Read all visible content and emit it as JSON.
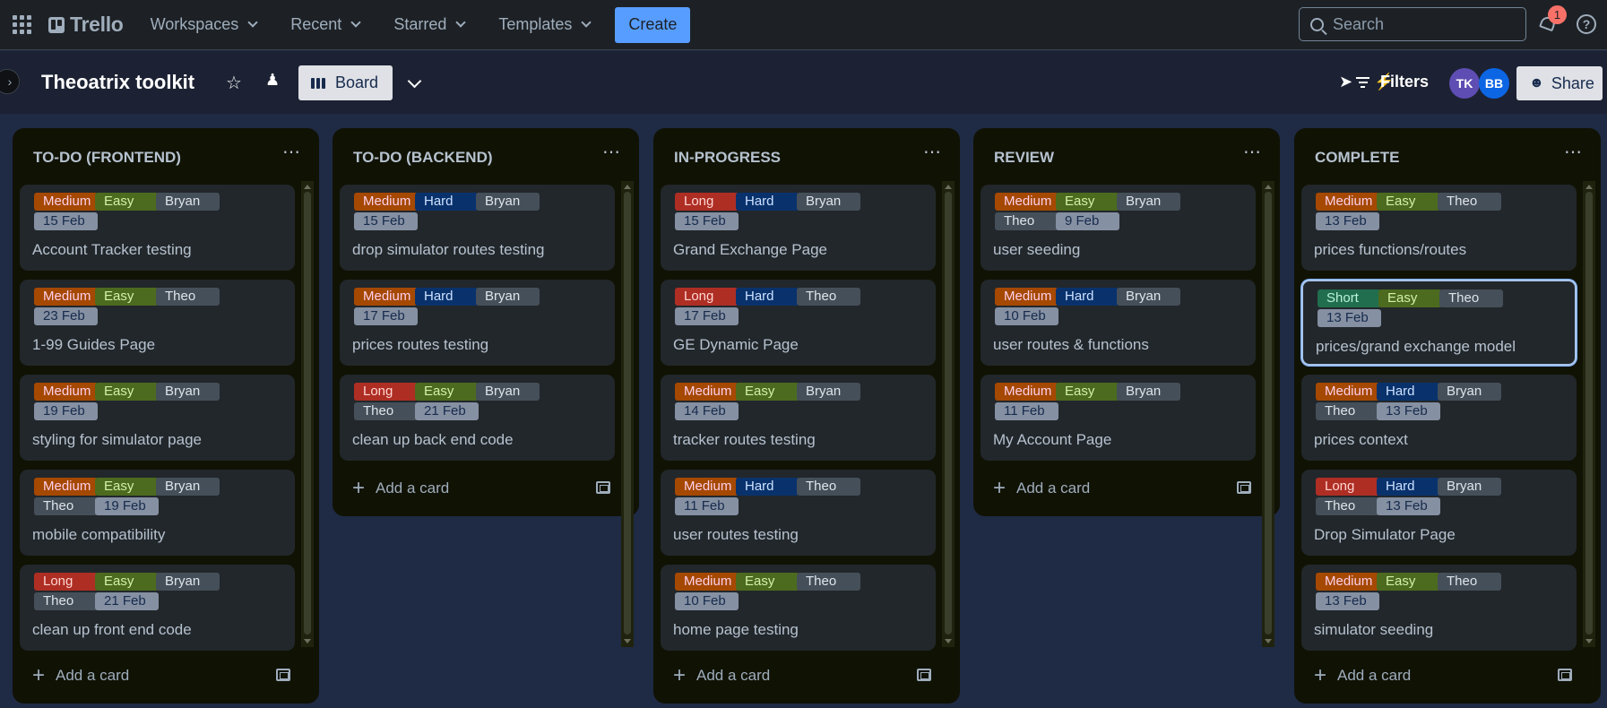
{
  "topnav": {
    "logo": "Trello",
    "menu": [
      "Workspaces",
      "Recent",
      "Starred",
      "Templates"
    ],
    "create_label": "Create",
    "search_placeholder": "Search",
    "notification_count": "1",
    "help_glyph": "?"
  },
  "board": {
    "title": "Theoatrix toolkit",
    "view_label": "Board",
    "filters_label": "Filters",
    "share_label": "Share",
    "members": [
      {
        "initials": "TK",
        "color": "#5e4db2"
      },
      {
        "initials": "BB",
        "color": "#0c66e4"
      }
    ]
  },
  "colors": {
    "Medium": {
      "bg": "#a54800",
      "fg": "#fdd0ec"
    },
    "Long": {
      "bg": "#ae2e24",
      "fg": "#ffd5d2"
    },
    "Short": {
      "bg": "#216e4e",
      "fg": "#baf3db"
    },
    "Easy": {
      "bg": "#4c6b1f",
      "fg": "#d3f1a7"
    },
    "Hard": {
      "bg": "#09326c",
      "fg": "#cce0ff"
    },
    "person": {
      "bg": "#454f59",
      "fg": "#dee4ea"
    },
    "date": {
      "bg": "#8590a2",
      "fg": "#172b4d"
    }
  },
  "add_card_label": "Add a card",
  "lists": [
    {
      "title": "TO-DO (FRONTEND)",
      "cards": [
        {
          "labels": [
            "Medium",
            "Easy",
            "Bryan"
          ],
          "members": [],
          "date": "15 Feb",
          "title": "Account Tracker testing"
        },
        {
          "labels": [
            "Medium",
            "Easy",
            "Theo"
          ],
          "members": [],
          "date": "23 Feb",
          "title": "1-99 Guides Page"
        },
        {
          "labels": [
            "Medium",
            "Easy",
            "Bryan"
          ],
          "members": [],
          "date": "19 Feb",
          "title": "styling for simulator page"
        },
        {
          "labels": [
            "Medium",
            "Easy",
            "Bryan"
          ],
          "members": [
            "Theo"
          ],
          "date": "19 Feb",
          "title": "mobile compatibility"
        },
        {
          "labels": [
            "Long",
            "Easy",
            "Bryan"
          ],
          "members": [
            "Theo"
          ],
          "date": "21 Feb",
          "title": "clean up front end code"
        }
      ]
    },
    {
      "title": "TO-DO (BACKEND)",
      "cards": [
        {
          "labels": [
            "Medium",
            "Hard",
            "Bryan"
          ],
          "members": [],
          "date": "15 Feb",
          "title": "drop simulator routes testing"
        },
        {
          "labels": [
            "Medium",
            "Hard",
            "Bryan"
          ],
          "members": [],
          "date": "17 Feb",
          "title": "prices routes testing"
        },
        {
          "labels": [
            "Long",
            "Easy",
            "Bryan"
          ],
          "members": [
            "Theo"
          ],
          "date": "21 Feb",
          "title": "clean up back end code"
        }
      ]
    },
    {
      "title": "IN-PROGRESS",
      "cards": [
        {
          "labels": [
            "Long",
            "Hard",
            "Bryan"
          ],
          "members": [],
          "date": "15 Feb",
          "title": "Grand Exchange Page"
        },
        {
          "labels": [
            "Long",
            "Hard",
            "Theo"
          ],
          "members": [],
          "date": "17 Feb",
          "title": "GE Dynamic Page"
        },
        {
          "labels": [
            "Medium",
            "Easy",
            "Bryan"
          ],
          "members": [],
          "date": "14 Feb",
          "title": "tracker routes testing"
        },
        {
          "labels": [
            "Medium",
            "Hard",
            "Theo"
          ],
          "members": [],
          "date": "11 Feb",
          "title": "user routes testing"
        },
        {
          "labels": [
            "Medium",
            "Easy",
            "Theo"
          ],
          "members": [],
          "date": "10 Feb",
          "title": "home page testing"
        }
      ]
    },
    {
      "title": "REVIEW",
      "cards": [
        {
          "labels": [
            "Medium",
            "Easy",
            "Bryan"
          ],
          "members": [
            "Theo"
          ],
          "date": "9 Feb",
          "title": "user seeding"
        },
        {
          "labels": [
            "Medium",
            "Hard",
            "Bryan"
          ],
          "members": [],
          "date": "10 Feb",
          "title": "user routes & functions"
        },
        {
          "labels": [
            "Medium",
            "Easy",
            "Bryan"
          ],
          "members": [],
          "date": "11 Feb",
          "title": "My Account Page"
        }
      ]
    },
    {
      "title": "COMPLETE",
      "cards": [
        {
          "labels": [
            "Medium",
            "Easy",
            "Theo"
          ],
          "members": [],
          "date": "13 Feb",
          "title": "prices functions/routes"
        },
        {
          "labels": [
            "Short",
            "Easy",
            "Theo"
          ],
          "members": [],
          "date": "13 Feb",
          "title": "prices/grand exchange model",
          "selected": true
        },
        {
          "labels": [
            "Medium",
            "Hard",
            "Bryan"
          ],
          "members": [
            "Theo"
          ],
          "date": "13 Feb",
          "title": "prices context"
        },
        {
          "labels": [
            "Long",
            "Hard",
            "Bryan"
          ],
          "members": [
            "Theo"
          ],
          "date": "13 Feb",
          "title": "Drop Simulator Page"
        },
        {
          "labels": [
            "Medium",
            "Easy",
            "Theo"
          ],
          "members": [],
          "date": "13 Feb",
          "title": "simulator seeding"
        }
      ]
    }
  ]
}
